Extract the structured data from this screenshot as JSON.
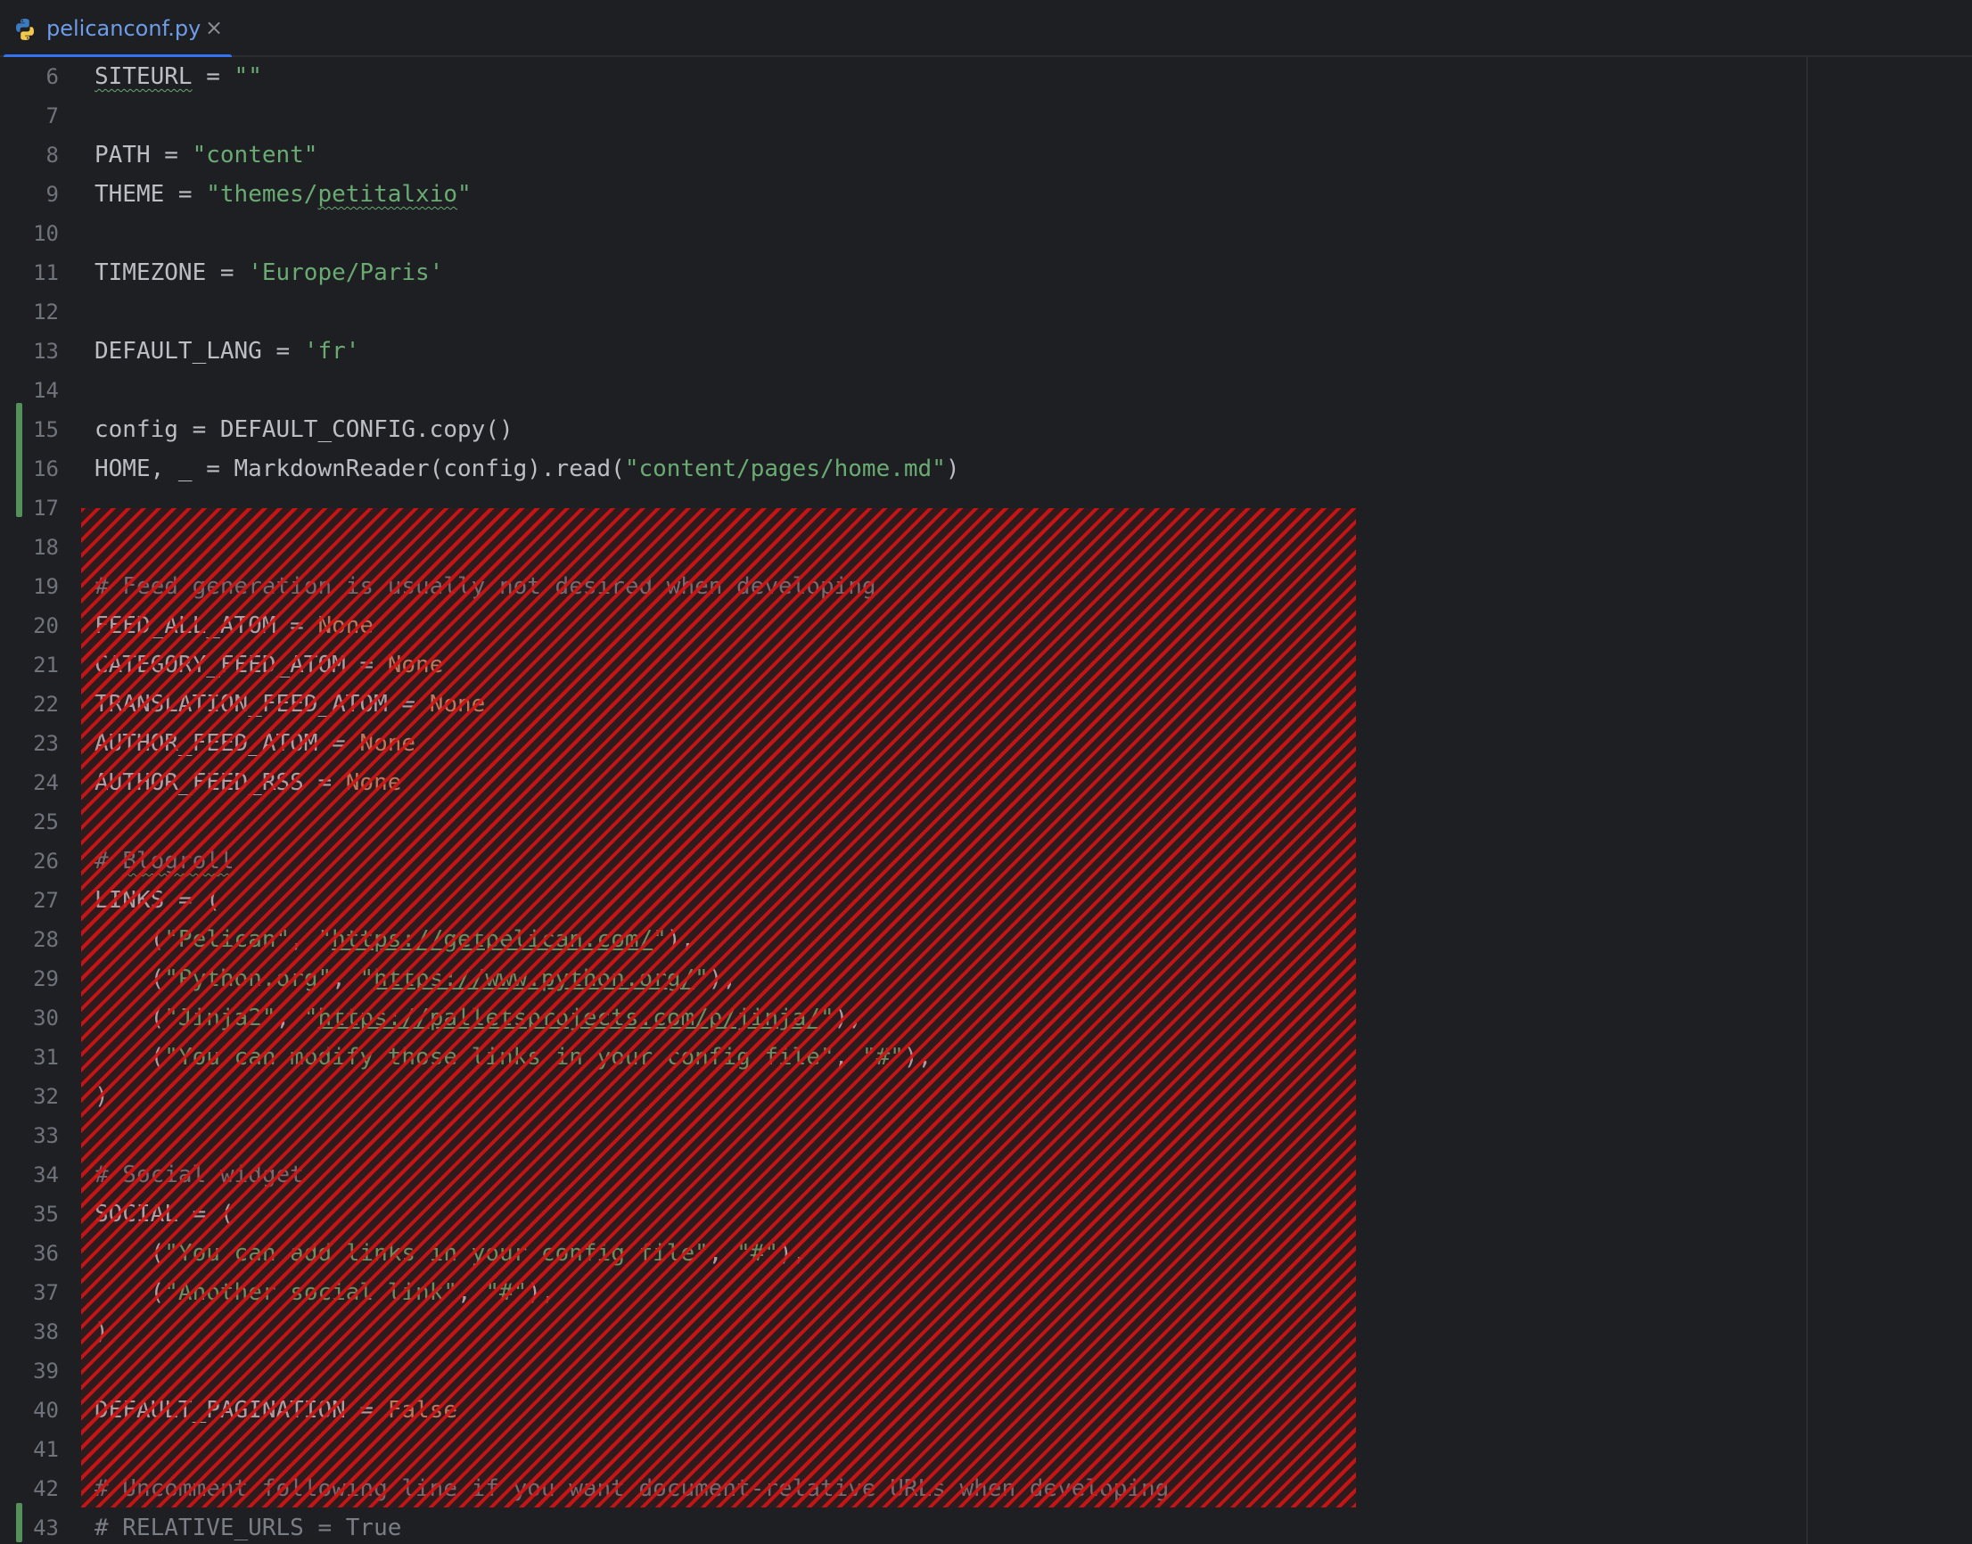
{
  "tab": {
    "filename": "pelicanconf.py",
    "close_glyph": "×",
    "icon": "python-icon"
  },
  "gutter": {
    "line_numbers": [
      "6",
      "7",
      "8",
      "9",
      "10",
      "11",
      "12",
      "13",
      "14",
      "15",
      "16",
      "17",
      "18",
      "19",
      "20",
      "21",
      "22",
      "23",
      "24",
      "25",
      "26",
      "27",
      "28",
      "29",
      "30",
      "31",
      "32",
      "33",
      "34",
      "35",
      "36",
      "37",
      "38",
      "39",
      "40",
      "41",
      "42",
      "43"
    ]
  },
  "code": {
    "l6": {
      "a": "SITEURL",
      "b": " = ",
      "c": "\"\""
    },
    "l8": {
      "a": "PATH = ",
      "b": "\"content\""
    },
    "l9": {
      "a": "THEME = ",
      "b": "\"themes/",
      "c": "petitalxio",
      "d": "\""
    },
    "l11": {
      "a": "TIMEZONE = ",
      "b": "'Europe/Paris'"
    },
    "l13": {
      "a": "DEFAULT_LANG = ",
      "b": "'fr'"
    },
    "l15": {
      "a": "config = DEFAULT_CONFIG.copy()"
    },
    "l16": {
      "a": "HOME, _ = MarkdownReader(config).read(",
      "b": "\"content/pages/home.md\"",
      "c": ")"
    },
    "l18": {
      "a": "# Feed generation is usually not desired when developing"
    },
    "l19": {
      "a": "FEED_ALL_ATOM = ",
      "b": "None"
    },
    "l20": {
      "a": "CATEGORY_FEED_ATOM = ",
      "b": "None"
    },
    "l21": {
      "a": "TRANSLATION_FEED_ATOM = ",
      "b": "None"
    },
    "l22": {
      "a": "AUTHOR_FEED_ATOM = ",
      "b": "None"
    },
    "l23": {
      "a": "AUTHOR_FEED_RSS = ",
      "b": "None"
    },
    "l25": {
      "a": "# ",
      "b": "Blogroll"
    },
    "l26": {
      "a": "LINKS = ("
    },
    "l27": {
      "a": "    (",
      "b": "\"Pelican\"",
      "c": ", ",
      "d": "\"",
      "e": "https://getpelican.com/",
      "f": "\"",
      "g": "),"
    },
    "l28": {
      "a": "    (",
      "b": "\"Python.org\"",
      "c": ", ",
      "d": "\"",
      "e": "https://www.python.org/",
      "f": "\"",
      "g": "),"
    },
    "l29": {
      "a": "    (",
      "b": "\"Jinja2\"",
      "c": ", ",
      "d": "\"",
      "e": "https://palletsprojects.com/p/jinja/",
      "f": "\"",
      "g": "),"
    },
    "l30": {
      "a": "    (",
      "b": "\"You can modify those links in your config file\"",
      "c": ", ",
      "d": "\"#\"",
      "e": "),"
    },
    "l31": {
      "a": ")"
    },
    "l33": {
      "a": "# Social widget"
    },
    "l34": {
      "a": "SOCIAL = ("
    },
    "l35": {
      "a": "    (",
      "b": "\"You can add links in your config file\"",
      "c": ", ",
      "d": "\"#\"",
      "e": "),"
    },
    "l36": {
      "a": "    (",
      "b": "\"Another social link\"",
      "c": ", ",
      "d": "\"#\"",
      "e": "),"
    },
    "l37": {
      "a": ")"
    },
    "l39": {
      "a": "DEFAULT_PAGINATION = ",
      "b": "False"
    },
    "l41": {
      "a": "# Uncomment following line if you want document-relative URLs when developing"
    },
    "l42": {
      "a": "# RELATIVE_URLS = True"
    }
  },
  "colors": {
    "background": "#1e1f22",
    "string": "#6aab73",
    "keyword": "#cf8e6d",
    "comment": "#7a7e85",
    "plain": "#bcbec4",
    "hatch": "#d21414",
    "change_marker": "#549159",
    "tab_accent": "#3574f0"
  }
}
